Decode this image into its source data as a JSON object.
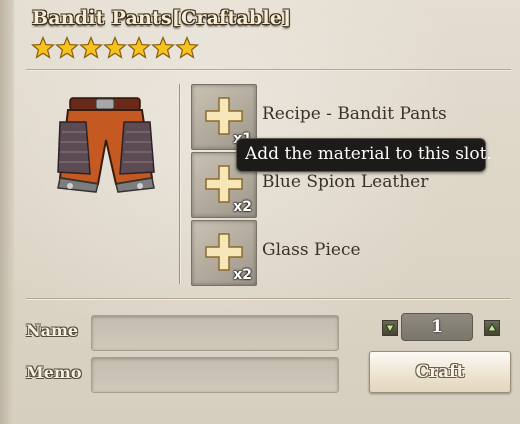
{
  "item": {
    "title": "Bandit Pants[Craftable]",
    "stars": 7,
    "image_icon": "pants-icon"
  },
  "materials": [
    {
      "name": "Recipe - Bandit Pants",
      "qty": "x1",
      "icon": "plus-icon"
    },
    {
      "name": "Blue Spion Leather",
      "qty": "x2",
      "icon": "plus-icon"
    },
    {
      "name": "Glass Piece",
      "qty": "x2",
      "icon": "plus-icon"
    }
  ],
  "tooltip": "Add the material to this slot.",
  "form": {
    "name_label": "Name",
    "memo_label": "Memo",
    "name_value": "",
    "memo_value": ""
  },
  "quantity": {
    "value": "1",
    "decrease_icon": "arrow-down-icon",
    "increase_icon": "arrow-up-icon"
  },
  "craft_label": "Craft",
  "colors": {
    "panel": "#ddd5c6",
    "star": "#f6c21c",
    "tooltip_bg": "#1d1b19"
  }
}
